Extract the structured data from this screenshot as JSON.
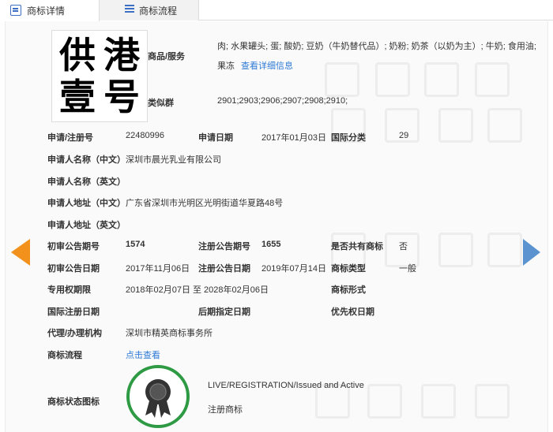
{
  "tabs": [
    {
      "label": "商标详情",
      "icon": "document-icon"
    },
    {
      "label": "商标流程",
      "icon": "list-icon"
    }
  ],
  "logo": {
    "chars": [
      "供",
      "港",
      "壹",
      "号"
    ]
  },
  "goods": {
    "label": "商品/服务",
    "line1": "肉; 水果罐头; 蛋; 酸奶; 豆奶（牛奶替代品）; 奶粉; 奶茶（以奶为主）; 牛奶; 食用油;",
    "line2": "果冻",
    "link": "查看详细信息"
  },
  "similar": {
    "label": "类似群",
    "value": "2901;2903;2906;2907;2908;2910;"
  },
  "fields": {
    "reg_no_label": "申请/注册号",
    "reg_no": "22480996",
    "apply_date_label": "申请日期",
    "apply_date": "2017年01月03日",
    "intl_class_label": "国际分类",
    "intl_class": "29",
    "applicant_cn_label": "申请人名称（中文）",
    "applicant_cn": "深圳市晨光乳业有限公司",
    "applicant_en_label": "申请人名称（英文）",
    "address_cn_label": "申请人地址（中文）",
    "address_cn": "广东省深圳市光明区光明街道华夏路48号",
    "address_en_label": "申请人地址（英文）",
    "pub_no_label": "初审公告期号",
    "pub_no": "1574",
    "reg_pub_no_label": "注册公告期号",
    "reg_pub_no": "1655",
    "shared_label": "是否共有商标",
    "shared": "否",
    "pub_date_label": "初审公告日期",
    "pub_date": "2017年11月06日",
    "reg_pub_date_label": "注册公告日期",
    "reg_pub_date": "2019年07月14日",
    "type_label": "商标类型",
    "type": "一般",
    "excl_label": "专用权期限",
    "excl": "2018年02月07日 至 2028年02月06日",
    "form_label": "商标形式",
    "intl_reg_label": "国际注册日期",
    "later_label": "后期指定日期",
    "priority_label": "优先权日期",
    "agent_label": "代理/办理机构",
    "agent": "深圳市精英商标事务所",
    "flow_label": "商标流程",
    "flow_link": "点击查看",
    "status_label": "商标状态图标",
    "status_en": "LIVE/REGISTRATION/Issued and Active",
    "status_cn": "注册商标"
  },
  "colors": {
    "accent_link": "#2e7ad6",
    "arrow_left": "#f2911b",
    "arrow_right": "#5a93d0",
    "badge_ring": "#2e9a44"
  },
  "navigation": {
    "prev_icon": "arrow-left-icon",
    "next_icon": "arrow-right-icon"
  }
}
